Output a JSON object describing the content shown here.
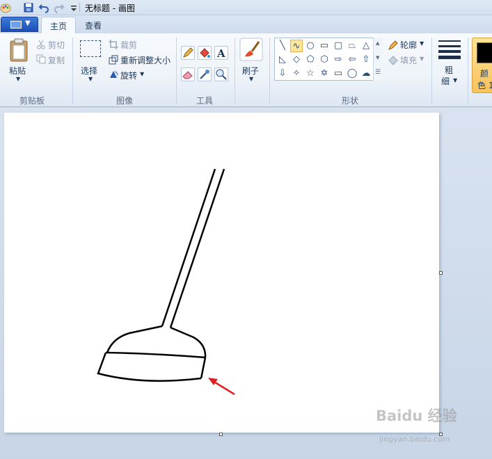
{
  "titlebar": {
    "title": "无标题 - 画图",
    "quick_access": [
      "save-icon",
      "undo-icon",
      "redo-icon",
      "customize-dropdown-icon"
    ]
  },
  "tabs": {
    "home": "主页",
    "view": "查看"
  },
  "ribbon": {
    "clipboard": {
      "paste": "粘贴",
      "cut": "剪切",
      "copy": "复制",
      "group": "剪贴板"
    },
    "image": {
      "select": "选择",
      "crop": "裁剪",
      "resize": "重新调整大小",
      "rotate": "旋转",
      "group": "图像"
    },
    "tools": {
      "group": "工具",
      "items": [
        "pencil-icon",
        "fill-bucket-icon",
        "text-icon",
        "eraser-icon",
        "color-picker-icon",
        "magnifier-icon"
      ]
    },
    "brushes": {
      "label": "刷子"
    },
    "shapes": {
      "group": "形状",
      "outline": "轮廓",
      "fill": "填充",
      "items": [
        "line",
        "curve",
        "oval",
        "rectangle",
        "rounded-rectangle",
        "polygon",
        "triangle",
        "right-triangle",
        "diamond",
        "pentagon",
        "hexagon",
        "right-arrow",
        "left-arrow",
        "up-arrow",
        "down-arrow",
        "four-point-star",
        "five-point-star",
        "six-point-star",
        "rounded-callout",
        "oval-callout",
        "cloud-callout"
      ],
      "selected": "curve"
    },
    "size": {
      "label_line1": "粗",
      "label_line2": "细"
    },
    "colors": {
      "label_line1": "颜",
      "label_line2": "色 1",
      "color1": "#000000"
    }
  },
  "canvas": {
    "background": "#ffffff"
  },
  "colors": {
    "arrow": "#e02020",
    "selected_tool": "#fde59b",
    "file_button": "#2a61c9"
  },
  "watermark": {
    "brand": "Baidu 经验",
    "site": "jingyan.baidu.com"
  }
}
